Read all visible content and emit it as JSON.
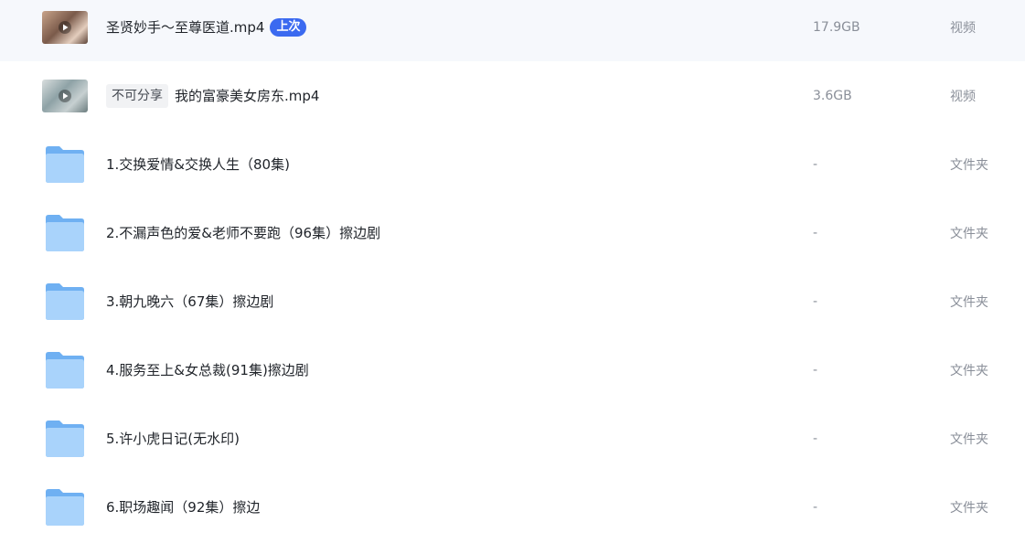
{
  "files": [
    {
      "kind": "video",
      "name": "圣贤妙手～至尊医道.mp4",
      "badge": "上次",
      "size": "17.9GB",
      "type": "视频",
      "thumb_icon": "play-icon"
    },
    {
      "kind": "video",
      "name": "我的富豪美女房东.mp4",
      "tag": "不可分享",
      "size": "3.6GB",
      "type": "视频",
      "thumb_icon": "play-icon"
    },
    {
      "kind": "folder",
      "name": "1.交换爱情&交换人生（80集)",
      "size": "-",
      "type": "文件夹",
      "icon": "folder-icon"
    },
    {
      "kind": "folder",
      "name": "2.不漏声色的爱&老师不要跑（96集）擦边剧",
      "size": "-",
      "type": "文件夹",
      "icon": "folder-icon"
    },
    {
      "kind": "folder",
      "name": "3.朝九晚六（67集）擦边剧",
      "size": "-",
      "type": "文件夹",
      "icon": "folder-icon"
    },
    {
      "kind": "folder",
      "name": "4.服务至上&女总裁(91集)擦边剧",
      "size": "-",
      "type": "文件夹",
      "icon": "folder-icon"
    },
    {
      "kind": "folder",
      "name": "5.许小虎日记(无水印)",
      "size": "-",
      "type": "文件夹",
      "icon": "folder-icon"
    },
    {
      "kind": "folder",
      "name": "6.职场趣闻（92集）擦边",
      "size": "-",
      "type": "文件夹",
      "icon": "folder-icon"
    }
  ],
  "colors": {
    "accent": "#3b6af0",
    "folder": "#8ec2f7",
    "text": "#1f2329",
    "muted": "#8a8f99"
  }
}
